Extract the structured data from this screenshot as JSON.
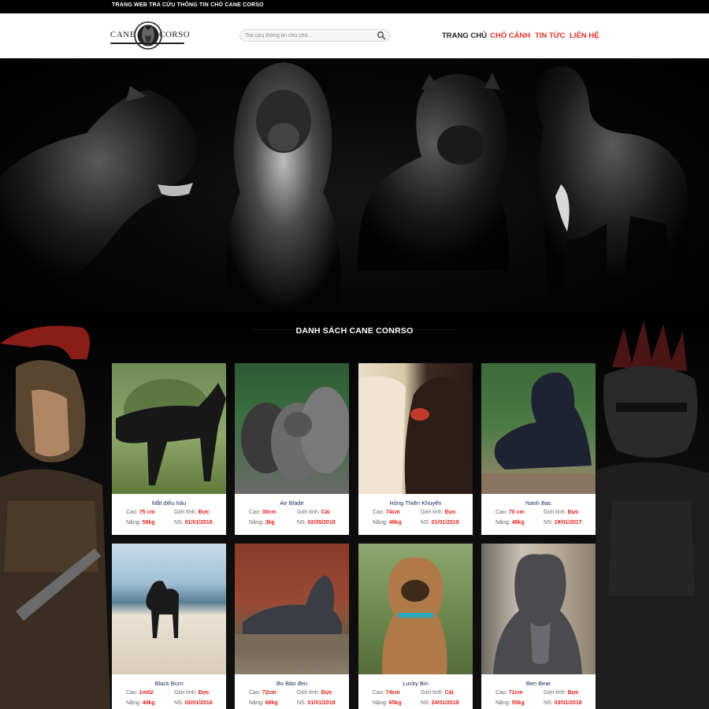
{
  "topbar": {
    "text": "TRANG WEB TRA CỨU THÔNG TIN CHÓ CANE CORSO"
  },
  "header": {
    "logo": {
      "left_word": "CANE",
      "right_word": "CORSO"
    },
    "search": {
      "placeholder": "Tra cứu thông tin chú chó..."
    },
    "nav": [
      {
        "label": "TRANG CHỦ"
      },
      {
        "label": "CHÓ CẢNH"
      },
      {
        "label": "TIN TỨC"
      },
      {
        "label": "LIÊN HỆ"
      }
    ]
  },
  "section": {
    "title": "DANH SÁCH CANE CONRSO"
  },
  "labels": {
    "height": "Cao:",
    "gender": "Giới tính:",
    "weight": "Nặng:",
    "dob": "NS:"
  },
  "dogs": [
    {
      "name": "Mắt diều hâu",
      "height": "75 cm",
      "gender": "Đực",
      "weight": "58kg",
      "dob": "01/01/2018"
    },
    {
      "name": "Air Blade",
      "height": "30cm",
      "gender": "Cái",
      "weight": "3kg",
      "dob": "02/05/2018"
    },
    {
      "name": "Hỏng Thiên Khuyển",
      "height": "74cm",
      "gender": "Đực",
      "weight": "48kg",
      "dob": "01/01/2018"
    },
    {
      "name": "Nanh Bạc",
      "height": "70 cm",
      "gender": "Đực",
      "weight": "48kg",
      "dob": "19/01/2017"
    },
    {
      "name": "Black Burn",
      "height": "1m02",
      "gender": "Đực",
      "weight": "40kg",
      "dob": "02/01/2016"
    },
    {
      "name": "Bo Báo đen",
      "height": "72cm",
      "gender": "Đực",
      "weight": "68kg",
      "dob": "01/01/2018"
    },
    {
      "name": "Lucky Bin",
      "height": "74cm",
      "gender": "Cái",
      "weight": "65kg",
      "dob": "24/01/2018"
    },
    {
      "name": "Ben Bear",
      "height": "71cm",
      "gender": "Đực",
      "weight": "55kg",
      "dob": "03/01/2018"
    }
  ],
  "colors": {
    "accent": "#e5211b",
    "nav_link": "#e5342a",
    "dog_name": "#1b2a5a",
    "page_bg": "#000000"
  },
  "icons": {
    "search": "search-icon"
  }
}
